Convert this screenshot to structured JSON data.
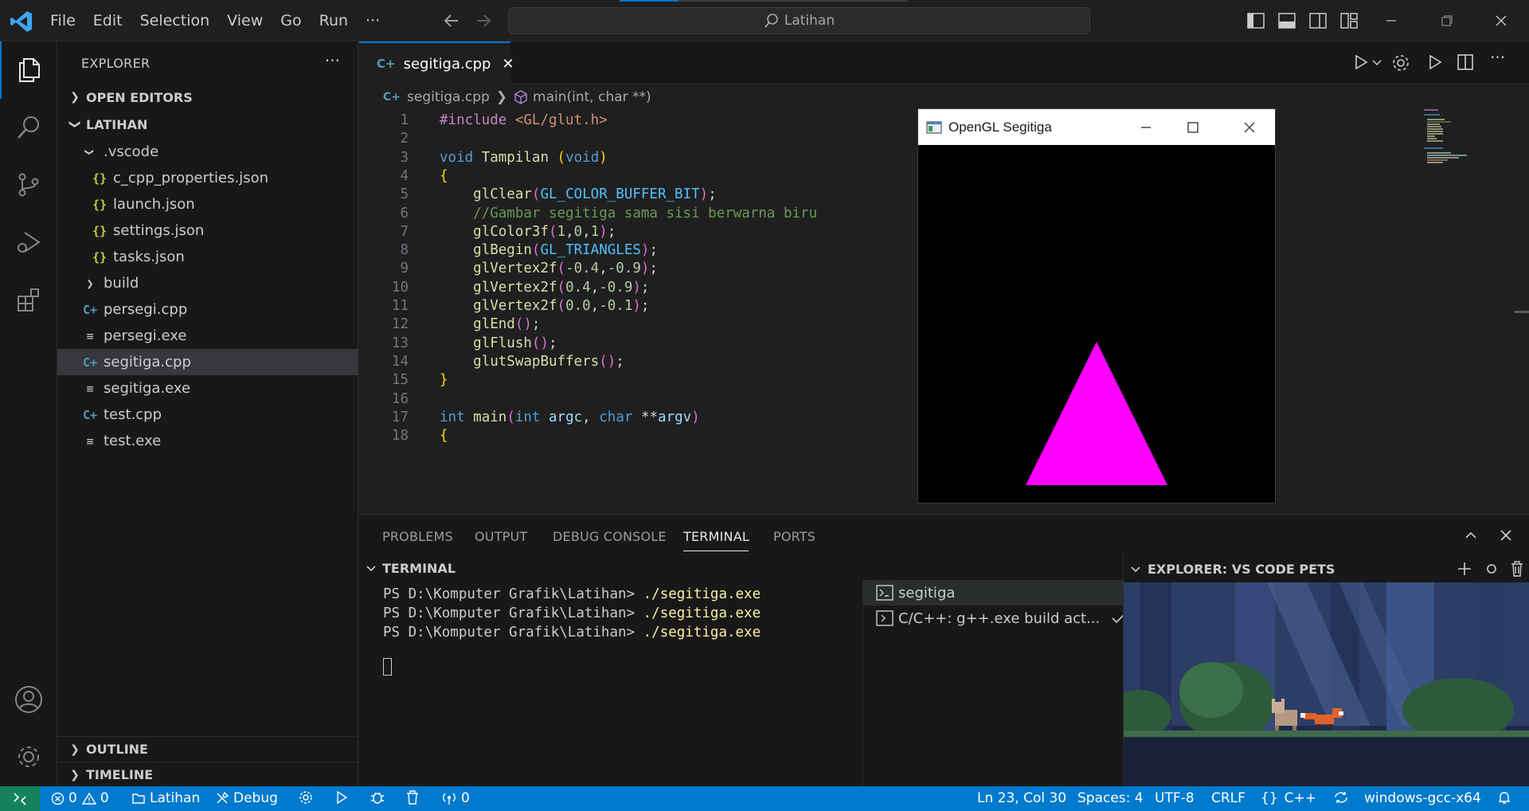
{
  "titlebar": {
    "menu": [
      "File",
      "Edit",
      "Selection",
      "View",
      "Go",
      "Run",
      "···"
    ],
    "search": "Latihan"
  },
  "sidebar": {
    "title": "EXPLORER",
    "more": "···",
    "open_editors": "OPEN EDITORS",
    "workspace": "LATIHAN",
    "items": [
      {
        "label": ".vscode",
        "icon": "chevron-down-icon",
        "indent": 1
      },
      {
        "label": "c_cpp_properties.json",
        "icon": "json-icon",
        "indent": 2
      },
      {
        "label": "launch.json",
        "icon": "json-icon",
        "indent": 2
      },
      {
        "label": "settings.json",
        "icon": "json-icon",
        "indent": 2
      },
      {
        "label": "tasks.json",
        "icon": "json-icon",
        "indent": 2
      },
      {
        "label": "build",
        "icon": "chevron-right-icon",
        "indent": 1
      },
      {
        "label": "persegi.cpp",
        "icon": "cpp-icon",
        "indent": 1
      },
      {
        "label": "persegi.exe",
        "icon": "file-icon",
        "indent": 1
      },
      {
        "label": "segitiga.cpp",
        "icon": "cpp-icon",
        "indent": 1,
        "selected": true
      },
      {
        "label": "segitiga.exe",
        "icon": "file-icon",
        "indent": 1
      },
      {
        "label": "test.cpp",
        "icon": "cpp-icon",
        "indent": 1
      },
      {
        "label": "test.exe",
        "icon": "file-icon",
        "indent": 1
      }
    ],
    "outline": "OUTLINE",
    "timeline": "TIMELINE"
  },
  "editor": {
    "tab": "segitiga.cpp",
    "breadcrumb_file": "segitiga.cpp",
    "breadcrumb_symbol": "main(int, char **)",
    "line_numbers": [
      "1",
      "2",
      "3",
      "4",
      "5",
      "6",
      "7",
      "8",
      "9",
      "10",
      "11",
      "12",
      "13",
      "14",
      "15",
      "16",
      "17",
      "18"
    ],
    "code": {
      "l1": [
        "#include",
        " ",
        "<GL/glut.h>"
      ],
      "l3": [
        "void",
        " ",
        "Tampilan",
        " ",
        "(",
        "void",
        ")"
      ],
      "l4": [
        "{"
      ],
      "l5": [
        "    ",
        "glClear",
        "(",
        "GL_COLOR_BUFFER_BIT",
        ")",
        ";"
      ],
      "l6": [
        "    ",
        "//Gambar segitiga sama sisi berwarna biru"
      ],
      "l7": [
        "    ",
        "glColor3f",
        "(",
        "1",
        ",",
        "0",
        ",",
        "1",
        ")",
        ";"
      ],
      "l8": [
        "    ",
        "glBegin",
        "(",
        "GL_TRIANGLES",
        ")",
        ";"
      ],
      "l9": [
        "    ",
        "glVertex2f",
        "(",
        "-0.4",
        ",",
        "-0.9",
        ")",
        ";"
      ],
      "l10": [
        "    ",
        "glVertex2f",
        "(",
        "0.4",
        ",",
        "-0.9",
        ")",
        ";"
      ],
      "l11": [
        "    ",
        "glVertex2f",
        "(",
        "0.0",
        ",",
        "-0.1",
        ")",
        ";"
      ],
      "l12": [
        "    ",
        "glEnd",
        "()",
        ";"
      ],
      "l13": [
        "    ",
        "glFlush",
        "()",
        ";"
      ],
      "l14": [
        "    ",
        "glutSwapBuffers",
        "()",
        ";"
      ],
      "l15": [
        "}"
      ],
      "l17": [
        "int",
        " ",
        "main",
        "(",
        "int",
        " ",
        "argc",
        ", ",
        "char",
        " ",
        "**",
        "argv",
        ")"
      ],
      "l18": [
        "{"
      ]
    }
  },
  "glwindow": {
    "title": "OpenGL Segitiga",
    "background": "#000000",
    "triangle_color": "#ff00ff"
  },
  "panel": {
    "tabs": [
      "PROBLEMS",
      "OUTPUT",
      "DEBUG CONSOLE",
      "TERMINAL",
      "PORTS"
    ],
    "active_tab": "TERMINAL",
    "terminal_title": "TERMINAL",
    "prompt": "PS D:\\Komputer Grafik\\Latihan> ",
    "command": "./segitiga.exe",
    "terminals": [
      "segitiga",
      "C/C++: g++.exe build act..."
    ]
  },
  "pets": {
    "title": "EXPLORER: VS CODE PETS"
  },
  "statusbar": {
    "errors": "0",
    "warnings": "0",
    "folder": "Latihan",
    "debug": "Debug",
    "ports": "0",
    "position": "Ln 23, Col 30",
    "spaces": "Spaces: 4",
    "encoding": "UTF-8",
    "eol": "CRLF",
    "language": "C++",
    "config": "windows-gcc-x64"
  },
  "colors": {
    "accent": "#0078d4",
    "statusbar": "#007acc",
    "remote": "#16825d"
  }
}
